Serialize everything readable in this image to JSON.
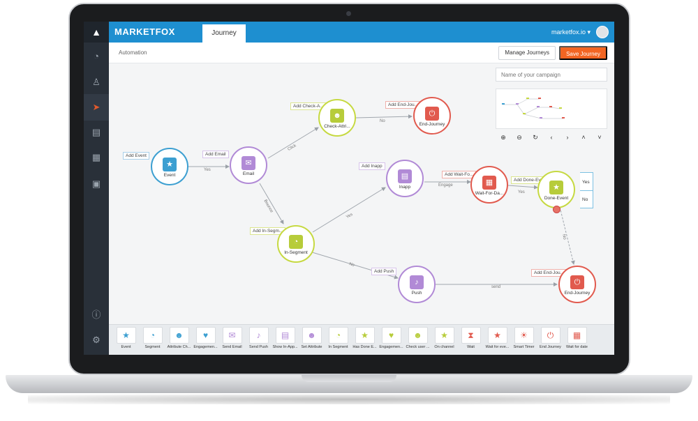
{
  "app": {
    "brand": "MARKETFOX",
    "tab": "Journey",
    "domain_menu": "marketfox.io ▾",
    "breadcrumb": "Automation",
    "manage_label": "Manage Journeys",
    "save_label": "Save Journey",
    "campaign_placeholder": "Name of your campaign"
  },
  "colors": {
    "topbar": "#1e8fd0",
    "sidebar": "#293039",
    "save": "#f26522",
    "blue": "#3c9fd1",
    "purple": "#b18ad6",
    "lime": "#c6d941",
    "red": "#e15a4e"
  },
  "sidebar_icons": [
    "dashboard-icon",
    "audience-icon",
    "campaign-icon",
    "reports-icon",
    "settings-grid-icon",
    "inbox-icon",
    "info-icon",
    "gear-icon"
  ],
  "zoom_controls": [
    "⊕",
    "⊖",
    "↻",
    "‹",
    "›",
    "˄",
    "˅"
  ],
  "nodes": {
    "event": {
      "label": "Event",
      "tag": "Add Event",
      "icon": "★"
    },
    "email": {
      "label": "Email",
      "tag": "Add Email",
      "icon": "✉"
    },
    "check": {
      "label": "Check-Attri...",
      "tag": "Add Check-A...",
      "icon": "☻"
    },
    "endtop": {
      "label": "End-Journey",
      "tag": "Add End-Jou...",
      "icon": "⏻"
    },
    "inapp": {
      "label": "Inapp",
      "tag": "Add Inapp",
      "icon": "▤"
    },
    "wait": {
      "label": "Wait-For-Da...",
      "tag": "Add Wait-Fo...",
      "icon": "▦"
    },
    "done": {
      "label": "Done-Event",
      "tag": "Add Done-Ev...",
      "icon": "★"
    },
    "segment": {
      "label": "In-Segment",
      "tag": "Add In-Segm...",
      "icon": "◔"
    },
    "push": {
      "label": "Push",
      "tag": "Add Push",
      "icon": "♪"
    },
    "endbottom": {
      "label": "End-Journey",
      "tag": "Add End-Jou...",
      "icon": "⏻"
    }
  },
  "edges": {
    "yes": "Yes",
    "click": "Click",
    "no": "No",
    "bounce": "Bounce",
    "engage": "Engage",
    "send": "send",
    "yes2": "Yes",
    "yes3": "Yes",
    "no2": "No",
    "no3": "No"
  },
  "branch": {
    "yes": "Yes",
    "no": "No"
  },
  "palette": [
    {
      "label": "Event",
      "icon": "★",
      "color": "#3c9fd1"
    },
    {
      "label": "Segment",
      "icon": "◔",
      "color": "#3c9fd1"
    },
    {
      "label": "Attribute Ch...",
      "icon": "☻",
      "color": "#3c9fd1"
    },
    {
      "label": "Engagemen...",
      "icon": "♥",
      "color": "#3c9fd1"
    },
    {
      "label": "Send Email",
      "icon": "✉",
      "color": "#b18ad6"
    },
    {
      "label": "Send Push",
      "icon": "♪",
      "color": "#b18ad6"
    },
    {
      "label": "Show In-App...",
      "icon": "▤",
      "color": "#b18ad6"
    },
    {
      "label": "Set Attribute",
      "icon": "☻",
      "color": "#b18ad6"
    },
    {
      "label": "In Segment",
      "icon": "◔",
      "color": "#b7cc3a"
    },
    {
      "label": "Has Done E...",
      "icon": "★",
      "color": "#b7cc3a"
    },
    {
      "label": "Engagemen...",
      "icon": "♥",
      "color": "#b7cc3a"
    },
    {
      "label": "Check user ...",
      "icon": "☻",
      "color": "#b7cc3a"
    },
    {
      "label": "On channel",
      "icon": "★",
      "color": "#b7cc3a"
    },
    {
      "label": "Wait",
      "icon": "⧗",
      "color": "#e15a4e"
    },
    {
      "label": "Wait for eve...",
      "icon": "★",
      "color": "#e15a4e"
    },
    {
      "label": "Smart Timer",
      "icon": "☀",
      "color": "#e15a4e"
    },
    {
      "label": "End Journey",
      "icon": "⏻",
      "color": "#e15a4e"
    },
    {
      "label": "Wait for date",
      "icon": "▦",
      "color": "#e15a4e"
    }
  ]
}
